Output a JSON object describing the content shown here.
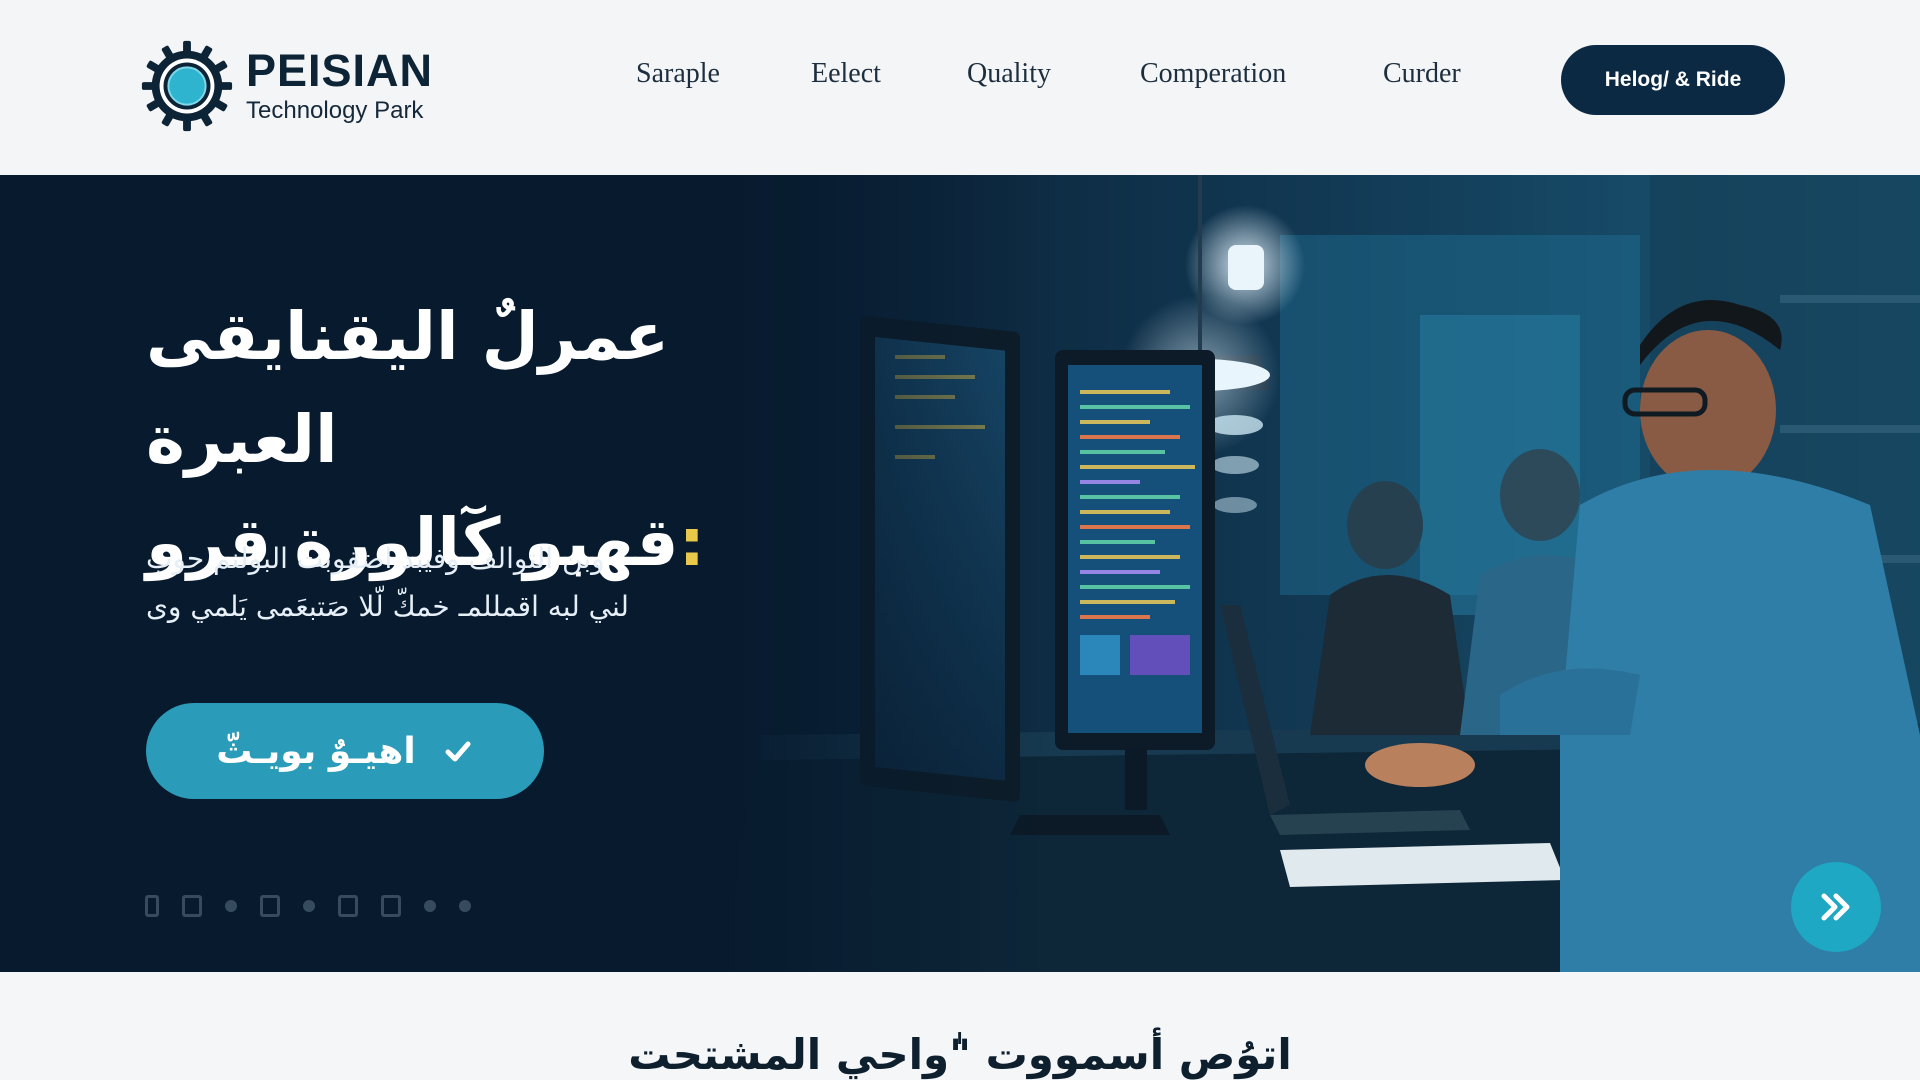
{
  "header": {
    "brand": {
      "title": "PEISIAN",
      "subtitle": "Technology Park"
    },
    "nav": [
      {
        "label": "Saraple"
      },
      {
        "label": "Eelect"
      },
      {
        "label": "Quality"
      },
      {
        "label": "Comperation"
      },
      {
        "label": "Curder"
      }
    ],
    "cta_label": "Helog/ & Ride"
  },
  "hero": {
    "title_line1": "عمرلٌ اليقنايقى العبرة",
    "title_line2": "قهبو كٓالورة قرو",
    "title_dot": ":",
    "desc_line1": "وبن التوالف وفيبد اضفوبت البولنم حوب",
    "desc_line2": "لني لبه اقمللمـ خمكّ لّلا صَتبعَمى يَلمي وى",
    "button_label": "اهيـوٌ بويـثّ",
    "button_icon": "check-icon",
    "next_icon": "double-chevron-right-icon",
    "accent_color": "#2a9bb8"
  },
  "section": {
    "title": "اتوُص أسمووت \"ٰواحي المشتحت"
  },
  "colors": {
    "navy": "#0b2942",
    "teal": "#1fa8c3",
    "background": "#f3f5f7"
  }
}
